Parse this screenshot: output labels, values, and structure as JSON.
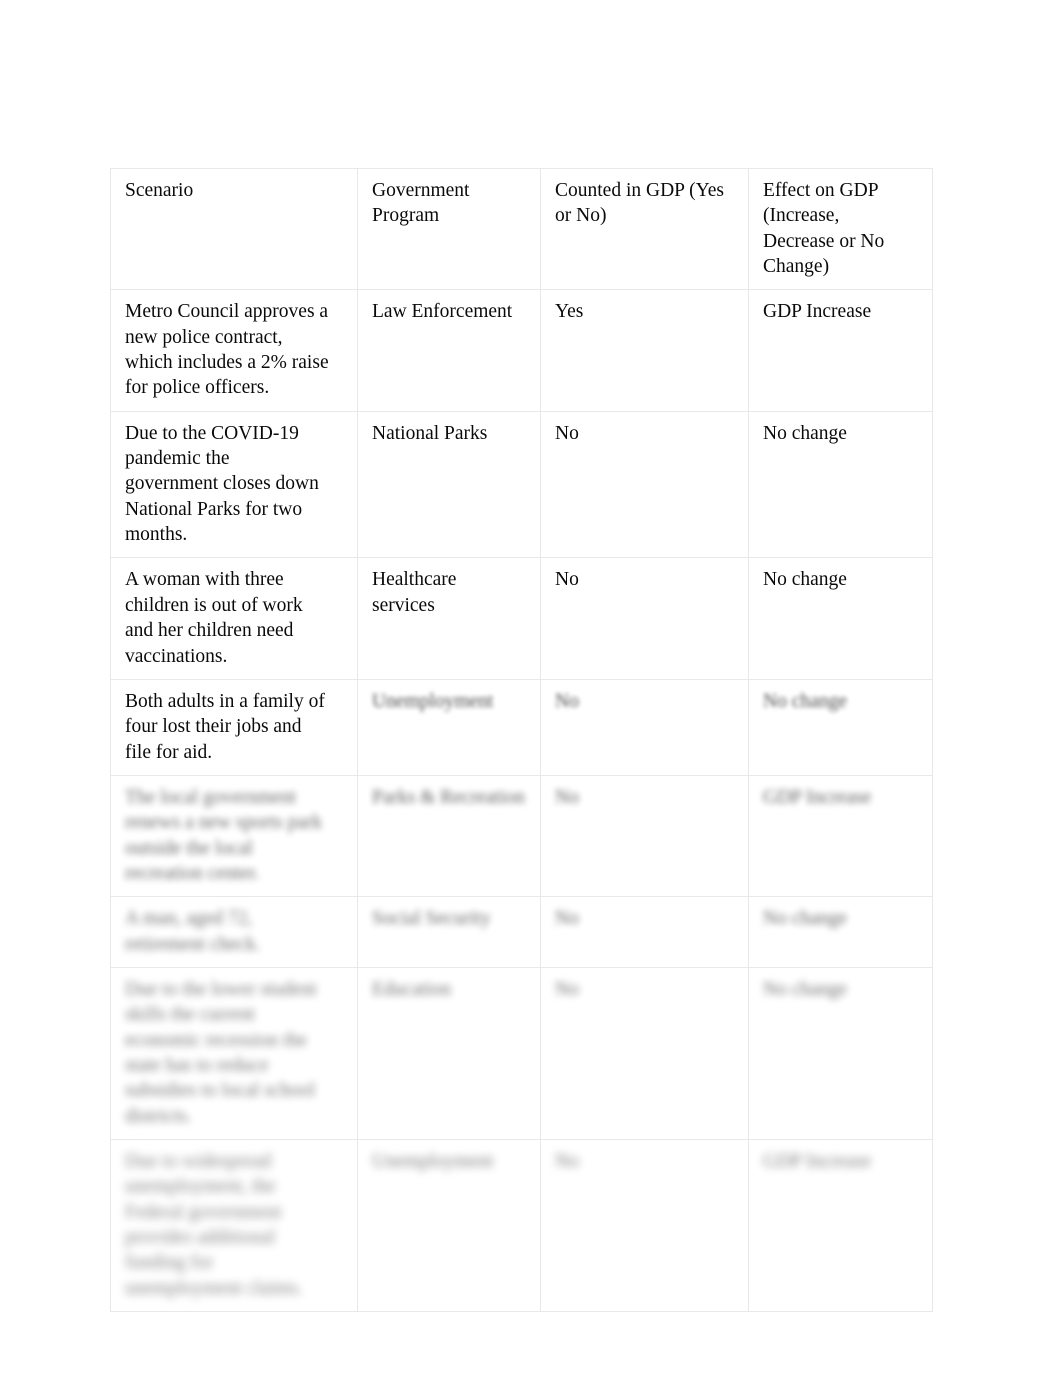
{
  "document": {
    "page_background": "#ffffff",
    "text_color": "#000000",
    "border_color": "#e8e8e8"
  },
  "table": {
    "name": "gdp-scenario-table",
    "columns": [
      {
        "key": "scenario",
        "header": "Scenario"
      },
      {
        "key": "program",
        "header": "Government\nProgram"
      },
      {
        "key": "counted",
        "header": "Counted in GDP (Yes\nor No)"
      },
      {
        "key": "effect",
        "header": "Effect on GDP\n(Increase,\nDecrease or No\nChange)"
      }
    ],
    "header_row": {
      "scenario": "Scenario",
      "program": "Government\nProgram",
      "counted": "Counted in GDP (Yes\nor No)",
      "effect": "Effect on GDP\n(Increase,\nDecrease or No\nChange)",
      "blur": 0
    },
    "rows": [
      {
        "scenario": "Metro Council approves a\nnew police contract,\nwhich includes a 2% raise\nfor police officers.",
        "program": "Law Enforcement",
        "counted": "Yes",
        "effect": "GDP Increase",
        "blur": 0,
        "cell_blur": {
          "scenario": 0,
          "program": 0,
          "counted": 0,
          "effect": 0
        }
      },
      {
        "scenario": "Due to the COVID-19\npandemic the\ngovernment closes down\nNational Parks for two\nmonths.",
        "program": "National Parks",
        "counted": "No",
        "effect": "No change",
        "blur": 0,
        "cell_blur": {
          "scenario": 0,
          "program": 0,
          "counted": 0,
          "effect": 0
        }
      },
      {
        "scenario": "A woman with three\nchildren is out of work\nand her children need\nvaccinations.",
        "program": "Healthcare\nservices",
        "counted": "No",
        "effect": "No change",
        "blur": 0,
        "cell_blur": {
          "scenario": 0,
          "program": 0,
          "counted": 0,
          "effect": 0
        }
      },
      {
        "scenario": "Both adults in a family of\nfour lost their jobs and\nfile for aid.",
        "program": "Unemployment",
        "counted": "No",
        "effect": "No change",
        "blur": 2.2,
        "cell_blur": {
          "scenario": 0,
          "program": 2.4,
          "counted": 2.4,
          "effect": 2.4
        }
      },
      {
        "scenario": "The local government\nrenews a new sports park\noutside the local\nrecreation center.",
        "program": "Parks & Recreation",
        "counted": "No",
        "effect": "GDP Increase",
        "blur": 3.1,
        "cell_blur": {
          "scenario": 3.4,
          "program": 3.1,
          "counted": 3.1,
          "effect": 3.1
        }
      },
      {
        "scenario": "A man, aged 72,\nretirement check.",
        "program": "Social Security",
        "counted": "No",
        "effect": "No change",
        "blur": 3.4,
        "cell_blur": {
          "scenario": 3.6,
          "program": 3.4,
          "counted": 3.4,
          "effect": 3.4
        }
      },
      {
        "scenario": "Due to the lower student\nskills the current\neconomic recession the\nstate has to reduce\nsubsidies to local school\ndistricts.",
        "program": "Education",
        "counted": "No",
        "effect": "No change",
        "blur": 3.8,
        "cell_blur": {
          "scenario": 4.0,
          "program": 3.8,
          "counted": 3.8,
          "effect": 3.8
        }
      },
      {
        "scenario": "Due to widespread\nunemployment, the\nFederal government\nprovides additional\nfunding for\nunemployment claims.",
        "program": "Unemployment",
        "counted": "No",
        "effect": "GDP Increase",
        "blur": 4.2,
        "cell_blur": {
          "scenario": 4.4,
          "program": 4.2,
          "counted": 4.2,
          "effect": 4.2
        }
      }
    ]
  }
}
